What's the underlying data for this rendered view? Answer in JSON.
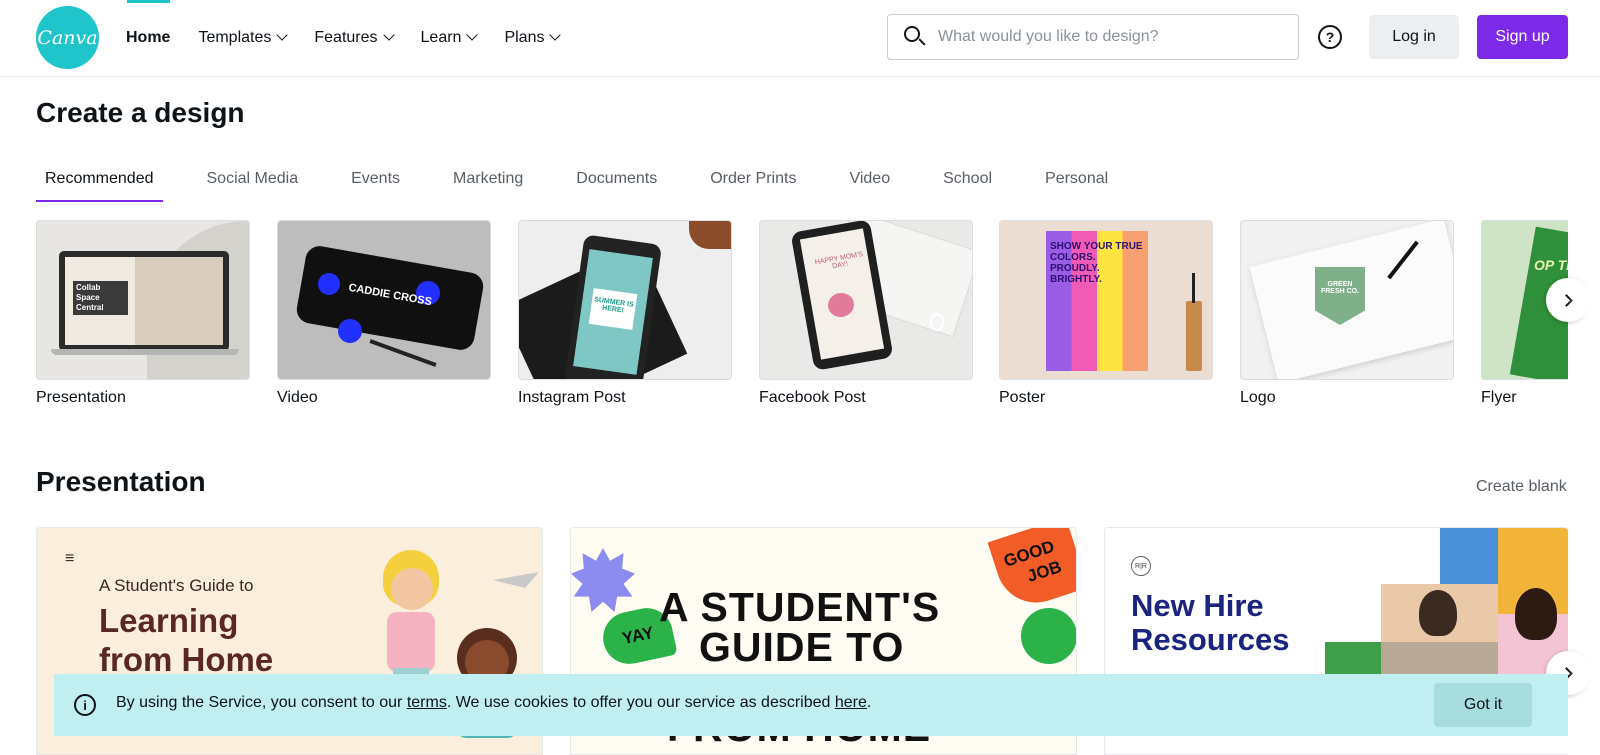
{
  "header": {
    "logo_text": "Canva",
    "nav": [
      {
        "label": "Home",
        "active": true,
        "dropdown": false
      },
      {
        "label": "Templates",
        "dropdown": true
      },
      {
        "label": "Features",
        "dropdown": true
      },
      {
        "label": "Learn",
        "dropdown": true
      },
      {
        "label": "Plans",
        "dropdown": true
      }
    ],
    "search_placeholder": "What would you like to design?",
    "help_symbol": "?",
    "login_label": "Log in",
    "signup_label": "Sign up"
  },
  "create": {
    "title": "Create a design",
    "tabs": [
      "Recommended",
      "Social Media",
      "Events",
      "Marketing",
      "Documents",
      "Order Prints",
      "Video",
      "School",
      "Personal"
    ],
    "active_tab": "Recommended",
    "cards": [
      {
        "label": "Presentation",
        "thumb_text": "Collab Space Central"
      },
      {
        "label": "Video",
        "thumb_text": "CADDIE CROSS"
      },
      {
        "label": "Instagram Post",
        "thumb_text": "SUMMER IS HERE!"
      },
      {
        "label": "Facebook Post",
        "thumb_text": "HAPPY MOM'S DAY!"
      },
      {
        "label": "Poster",
        "thumb_text": "SHOW YOUR TRUE COLORS. PROUDLY. BRIGHTLY."
      },
      {
        "label": "Logo",
        "thumb_text": "GREEN FRESH CO."
      },
      {
        "label": "Flyer",
        "thumb_text": "OP TRY"
      }
    ]
  },
  "presentation": {
    "title": "Presentation",
    "create_blank": "Create blank",
    "templates": [
      {
        "menu": "≡",
        "line1": "A Student's Guide to",
        "line2": "Learning",
        "line3": "from Home"
      },
      {
        "line1": "A STUDENT'S",
        "line2": "GUIDE TO",
        "line3": "FROM HOME",
        "sticker_good": "GOOD",
        "sticker_job": "JOB",
        "sticker_yay": "YAY"
      },
      {
        "badge": "R|R",
        "line1": "New Hire",
        "line2": "Resources"
      }
    ]
  },
  "cookie": {
    "text_before": "By using the Service, you consent to our ",
    "terms_link": "terms",
    "text_middle": ". We use cookies to offer you our service as described ",
    "here_link": "here",
    "text_after": ".",
    "button": "Got it",
    "info_symbol": "i"
  },
  "colors": {
    "brand_teal": "#20c4cb",
    "brand_purple": "#7d2ae8",
    "cookie_bg": "#c1eef0"
  },
  "icons": [
    "search-icon",
    "help-icon",
    "chevron-down-icon",
    "chevron-right-icon",
    "info-icon"
  ]
}
